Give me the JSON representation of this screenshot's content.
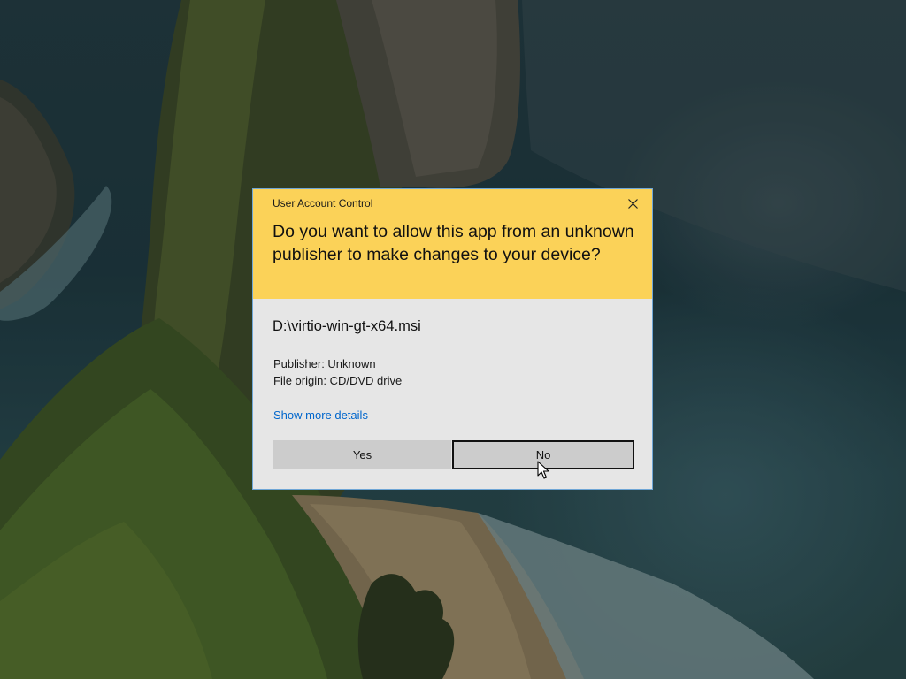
{
  "dialog": {
    "title": "User Account Control",
    "question": "Do you want to allow this app from an unknown publisher to make changes to your device?",
    "file_name": "D:\\virtio-win-gt-x64.msi",
    "publisher": "Publisher: Unknown",
    "file_origin": "File origin: CD/DVD drive",
    "details_link": "Show more details",
    "yes_label": "Yes",
    "no_label": "No",
    "close_icon": "close-icon",
    "focused_button": "No"
  },
  "colors": {
    "header_bg": "#fbd258",
    "body_bg": "#e6e6e6",
    "link": "#0066cc",
    "button_bg": "#cccccc",
    "border": "#6fa6d6"
  },
  "cursor": {
    "icon": "arrow-pointer-icon"
  }
}
